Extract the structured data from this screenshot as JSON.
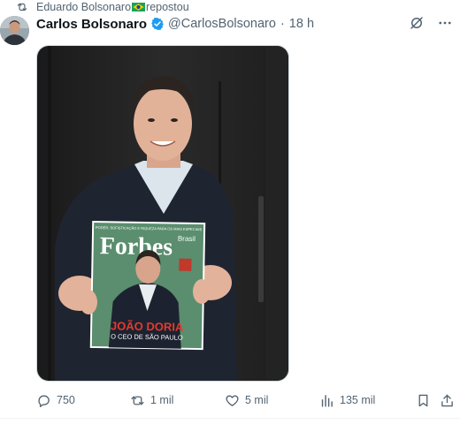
{
  "repost": {
    "user": "Eduardo Bolsonaro",
    "flag_icon": "brazil-flag-icon",
    "label": "repostou"
  },
  "post": {
    "display_name": "Carlos Bolsonaro",
    "verified": true,
    "handle": "@CarlosBolsonaro",
    "separator": "·",
    "time": "18 h",
    "media": {
      "magazine": {
        "tagline": "PODER, SOFISTICAÇÃO E RIQUEZA PARA OS MAIS ESPECIAIS",
        "title": "Forbes",
        "edition": "Brasil",
        "headline": "JOÃO DORIA",
        "subheadline": "O CEO DE SÃO PAULO"
      }
    }
  },
  "actions": {
    "replies": "750",
    "reposts": "1 mil",
    "likes": "5 mil",
    "views": "135 mil"
  },
  "colors": {
    "text_primary": "#0f1419",
    "text_secondary": "#536471",
    "verified_blue": "#1d9bf0",
    "divider": "#eff3f4"
  }
}
